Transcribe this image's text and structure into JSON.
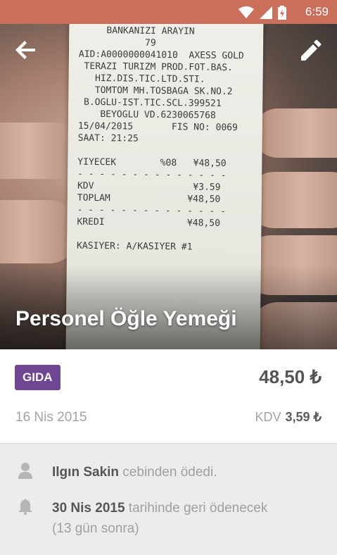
{
  "status_bar": {
    "time": "6:59"
  },
  "hero": {
    "title": "Personel Öğle Yemeği",
    "receipt_lines": [
      "     BANKANIZI ARAYIN",
      "            79",
      "AID:A0000000041010  AXESS GOLD",
      " TERAZI TURIZM PROD.FOT.BAS.",
      "   HIZ.DIS.TIC.LTD.STI.",
      "   TOMTOM MH.TOSBAGA SK.NO.2",
      " B.OGLU-IST.TIC.SCL.399521",
      "    BEYOGLU VD.6230065768",
      "15/04/2015       FIS NO: 0069",
      "SAAT: 21:25",
      "",
      "YIYECEK        %08   ¥48,50",
      "- - - - - - - - - - - - - -",
      "KDV                  ¥3.59",
      "TOPLAM              ¥48,50",
      "- - - - - - - - - - - - - -",
      "KREDI               ¥48,50",
      "",
      "KASIYER: A/KASIYER #1"
    ]
  },
  "details": {
    "category": "GIDA",
    "amount": "48,50 ₺",
    "date": "16 Nis 2015",
    "kdv_label": "KDV",
    "kdv_value": "3,59 ₺"
  },
  "info": {
    "payer_name": "Ilgın Sakin",
    "payer_suffix": " cebinden ödedi.",
    "refund_date": "30 Nis 2015",
    "refund_suffix": " tarihinde geri ödenecek",
    "refund_note": "(13 gün sonra)"
  },
  "colors": {
    "status_bar": "#c96f5c",
    "category_badge": "#6e4691",
    "info_bg": "#ececec"
  }
}
